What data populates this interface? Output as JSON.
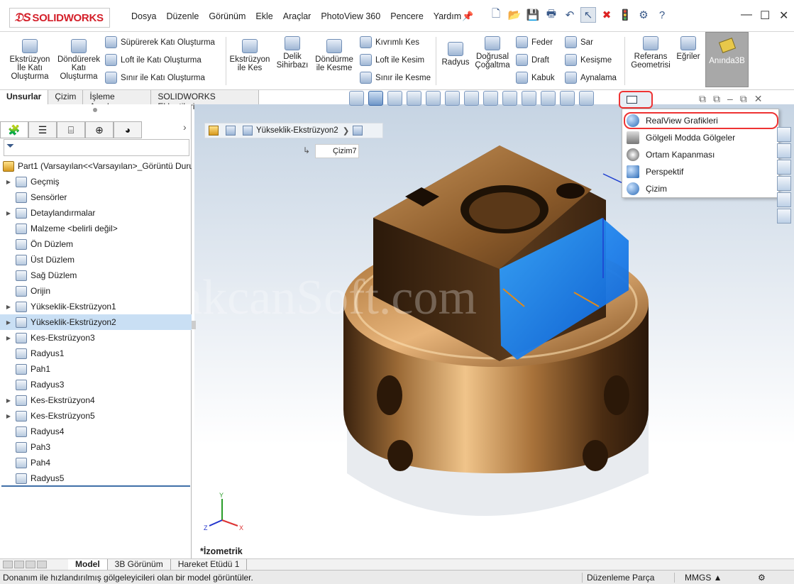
{
  "app": {
    "brand": "SOLIDWORKS"
  },
  "menu": [
    "Dosya",
    "Düzenle",
    "Görünüm",
    "Ekle",
    "Araçlar",
    "PhotoView 360",
    "Pencere",
    "Yardım"
  ],
  "ribbon": {
    "big1": {
      "l1": "Ekstrüzyon",
      "l2": "İle Katı",
      "l3": "Oluşturma"
    },
    "big2": {
      "l1": "Döndürerek",
      "l2": "Katı",
      "l3": "Oluşturma"
    },
    "small1": [
      "Süpürerek Katı Oluşturma",
      "Loft ile Katı Oluşturma",
      "Sınır ile Katı Oluşturma"
    ],
    "big3": {
      "l1": "Ekstrüzyon",
      "l2": "ile Kes"
    },
    "big4": {
      "l1": "Delik",
      "l2": "Sihirbazı"
    },
    "big5": {
      "l1": "Döndürme",
      "l2": "ile Kesme"
    },
    "small2": [
      "Kıvrımlı Kes",
      "Loft ile Kesim",
      "Sınır ile Kesme"
    ],
    "big6": {
      "l1": "Radyus"
    },
    "big7": {
      "l1": "Doğrusal",
      "l2": "Çoğaltma"
    },
    "small3": [
      "Feder",
      "Draft",
      "Kabuk"
    ],
    "small4": [
      "Sar",
      "Kesişme",
      "Aynalama"
    ],
    "big8": {
      "l1": "Referans",
      "l2": "Geometrisi"
    },
    "big9": {
      "l1": "Eğriler"
    },
    "instant": "Anında3B"
  },
  "cmtabs": [
    "Unsurlar",
    "Çizim",
    "İşleme Araçları",
    "SOLIDWORKS Eklentileri"
  ],
  "tree": [
    {
      "label": "Part1  (Varsayılan<<Varsayılan>_Görüntü Duru",
      "exp": ""
    },
    {
      "label": "Geçmiş",
      "exp": "▶"
    },
    {
      "label": "Sensörler",
      "exp": ""
    },
    {
      "label": "Detaylandırmalar",
      "exp": "▶"
    },
    {
      "label": "Malzeme <belirli değil>",
      "exp": ""
    },
    {
      "label": "Ön Düzlem",
      "exp": ""
    },
    {
      "label": "Üst Düzlem",
      "exp": ""
    },
    {
      "label": "Sağ Düzlem",
      "exp": ""
    },
    {
      "label": "Orijin",
      "exp": ""
    },
    {
      "label": "Yükseklik-Ekstrüzyon1",
      "exp": "▶"
    },
    {
      "label": "Yükseklik-Ekstrüzyon2",
      "exp": "▶"
    },
    {
      "label": "Kes-Ekstrüzyon3",
      "exp": "▶"
    },
    {
      "label": "Radyus1",
      "exp": ""
    },
    {
      "label": "Pah1",
      "exp": ""
    },
    {
      "label": "Radyus3",
      "exp": ""
    },
    {
      "label": "Kes-Ekstrüzyon4",
      "exp": "▶"
    },
    {
      "label": "Kes-Ekstrüzyon5",
      "exp": "▶"
    },
    {
      "label": "Radyus4",
      "exp": ""
    },
    {
      "label": "Pah3",
      "exp": ""
    },
    {
      "label": "Pah4",
      "exp": ""
    },
    {
      "label": "Radyus5",
      "exp": ""
    }
  ],
  "breadcrumb": {
    "label": "Yükseklik-Ekstrüzyon2",
    "sketch": "Çizim7"
  },
  "dropdown": [
    "RealView Grafikleri",
    "Gölgeli Modda Gölgeler",
    "Ortam Kapanması",
    "Perspektif",
    "Çizim"
  ],
  "view": {
    "orientation": "*İzometrik",
    "watermark": "akcanSoft.com"
  },
  "bottomtabs": [
    "Model",
    "3B Görünüm",
    "Hareket Etüdü 1"
  ],
  "status": {
    "hint": "Donanım ile hızlandırılmış gölgeleyicileri olan bir model görüntüler.",
    "mode": "Düzenleme Parça",
    "units": "MMGS ▲"
  }
}
